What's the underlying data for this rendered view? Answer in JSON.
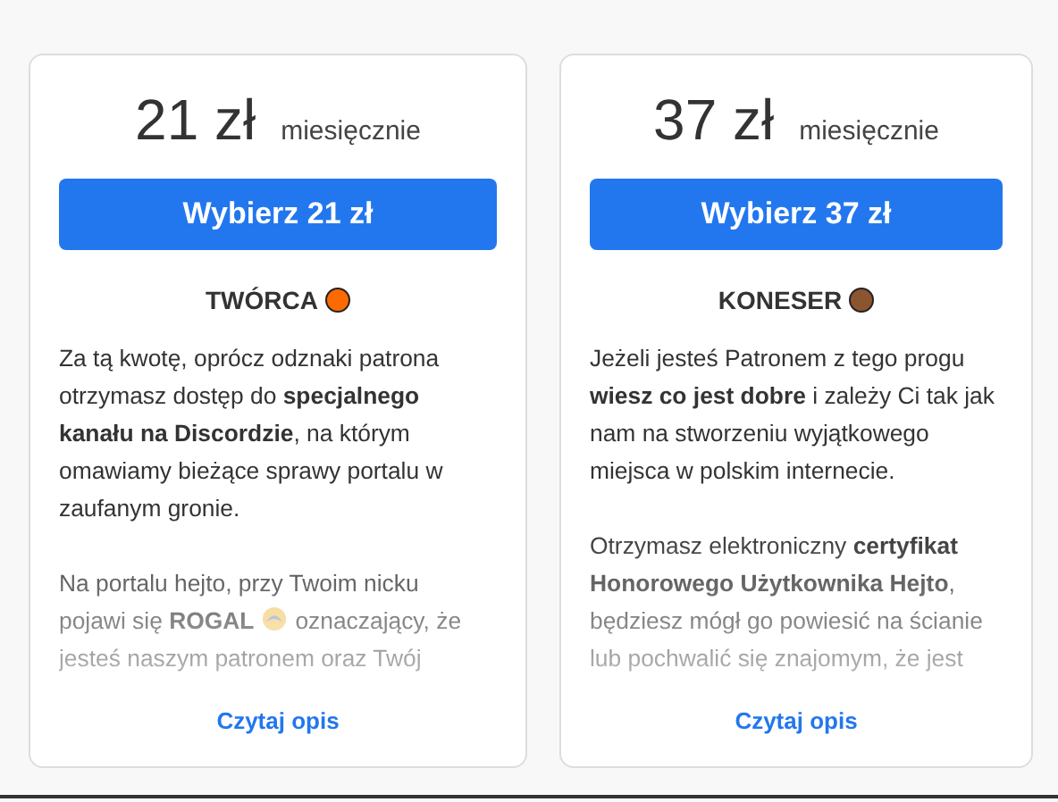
{
  "plans": [
    {
      "price": "21 zł",
      "period": "miesięcznie",
      "button": "Wybierz 21 zł",
      "tier": {
        "name": "TWÓRCA",
        "color": "#ff6a00"
      },
      "paragraphs": [
        [
          {
            "kind": "text",
            "text": "Za tą kwotę, oprócz odznaki patrona otrzymasz dostęp do **specjalnego kanału na Discordzie**, na którym omawiamy bieżące sprawy portalu w zaufanym gronie."
          }
        ],
        [
          {
            "kind": "line",
            "text": "Na portalu hejto, przy Twoim nicku"
          },
          {
            "kind": "phrase",
            "text": "pojawi się **ROGAL**"
          },
          {
            "kind": "icon"
          },
          {
            "kind": "phrase",
            "text": "oznaczający, że"
          },
          {
            "kind": "line",
            "text": "jesteś naszym patronem oraz Twój"
          }
        ]
      ],
      "link": "Czytaj opis"
    },
    {
      "price": "37 zł",
      "period": "miesięcznie",
      "button": "Wybierz 37 zł",
      "tier": {
        "name": "KONESER",
        "color": "#8b5530"
      },
      "paragraphs": [
        [
          {
            "kind": "text",
            "text": "Jeżeli jesteś Patronem z tego progu **wiesz co jest dobre** i zależy Ci tak jak nam na stworzeniu wyjątkowego miejsca w polskim internecie."
          }
        ],
        [
          {
            "kind": "text",
            "text": "Otrzymasz elektroniczny **certyfikat Honorowego Użytkownika Hejto**, będziesz mógł go powiesić na ścianie lub pochwalić się znajomym, że jest"
          }
        ]
      ],
      "link": "Czytaj opis"
    }
  ]
}
